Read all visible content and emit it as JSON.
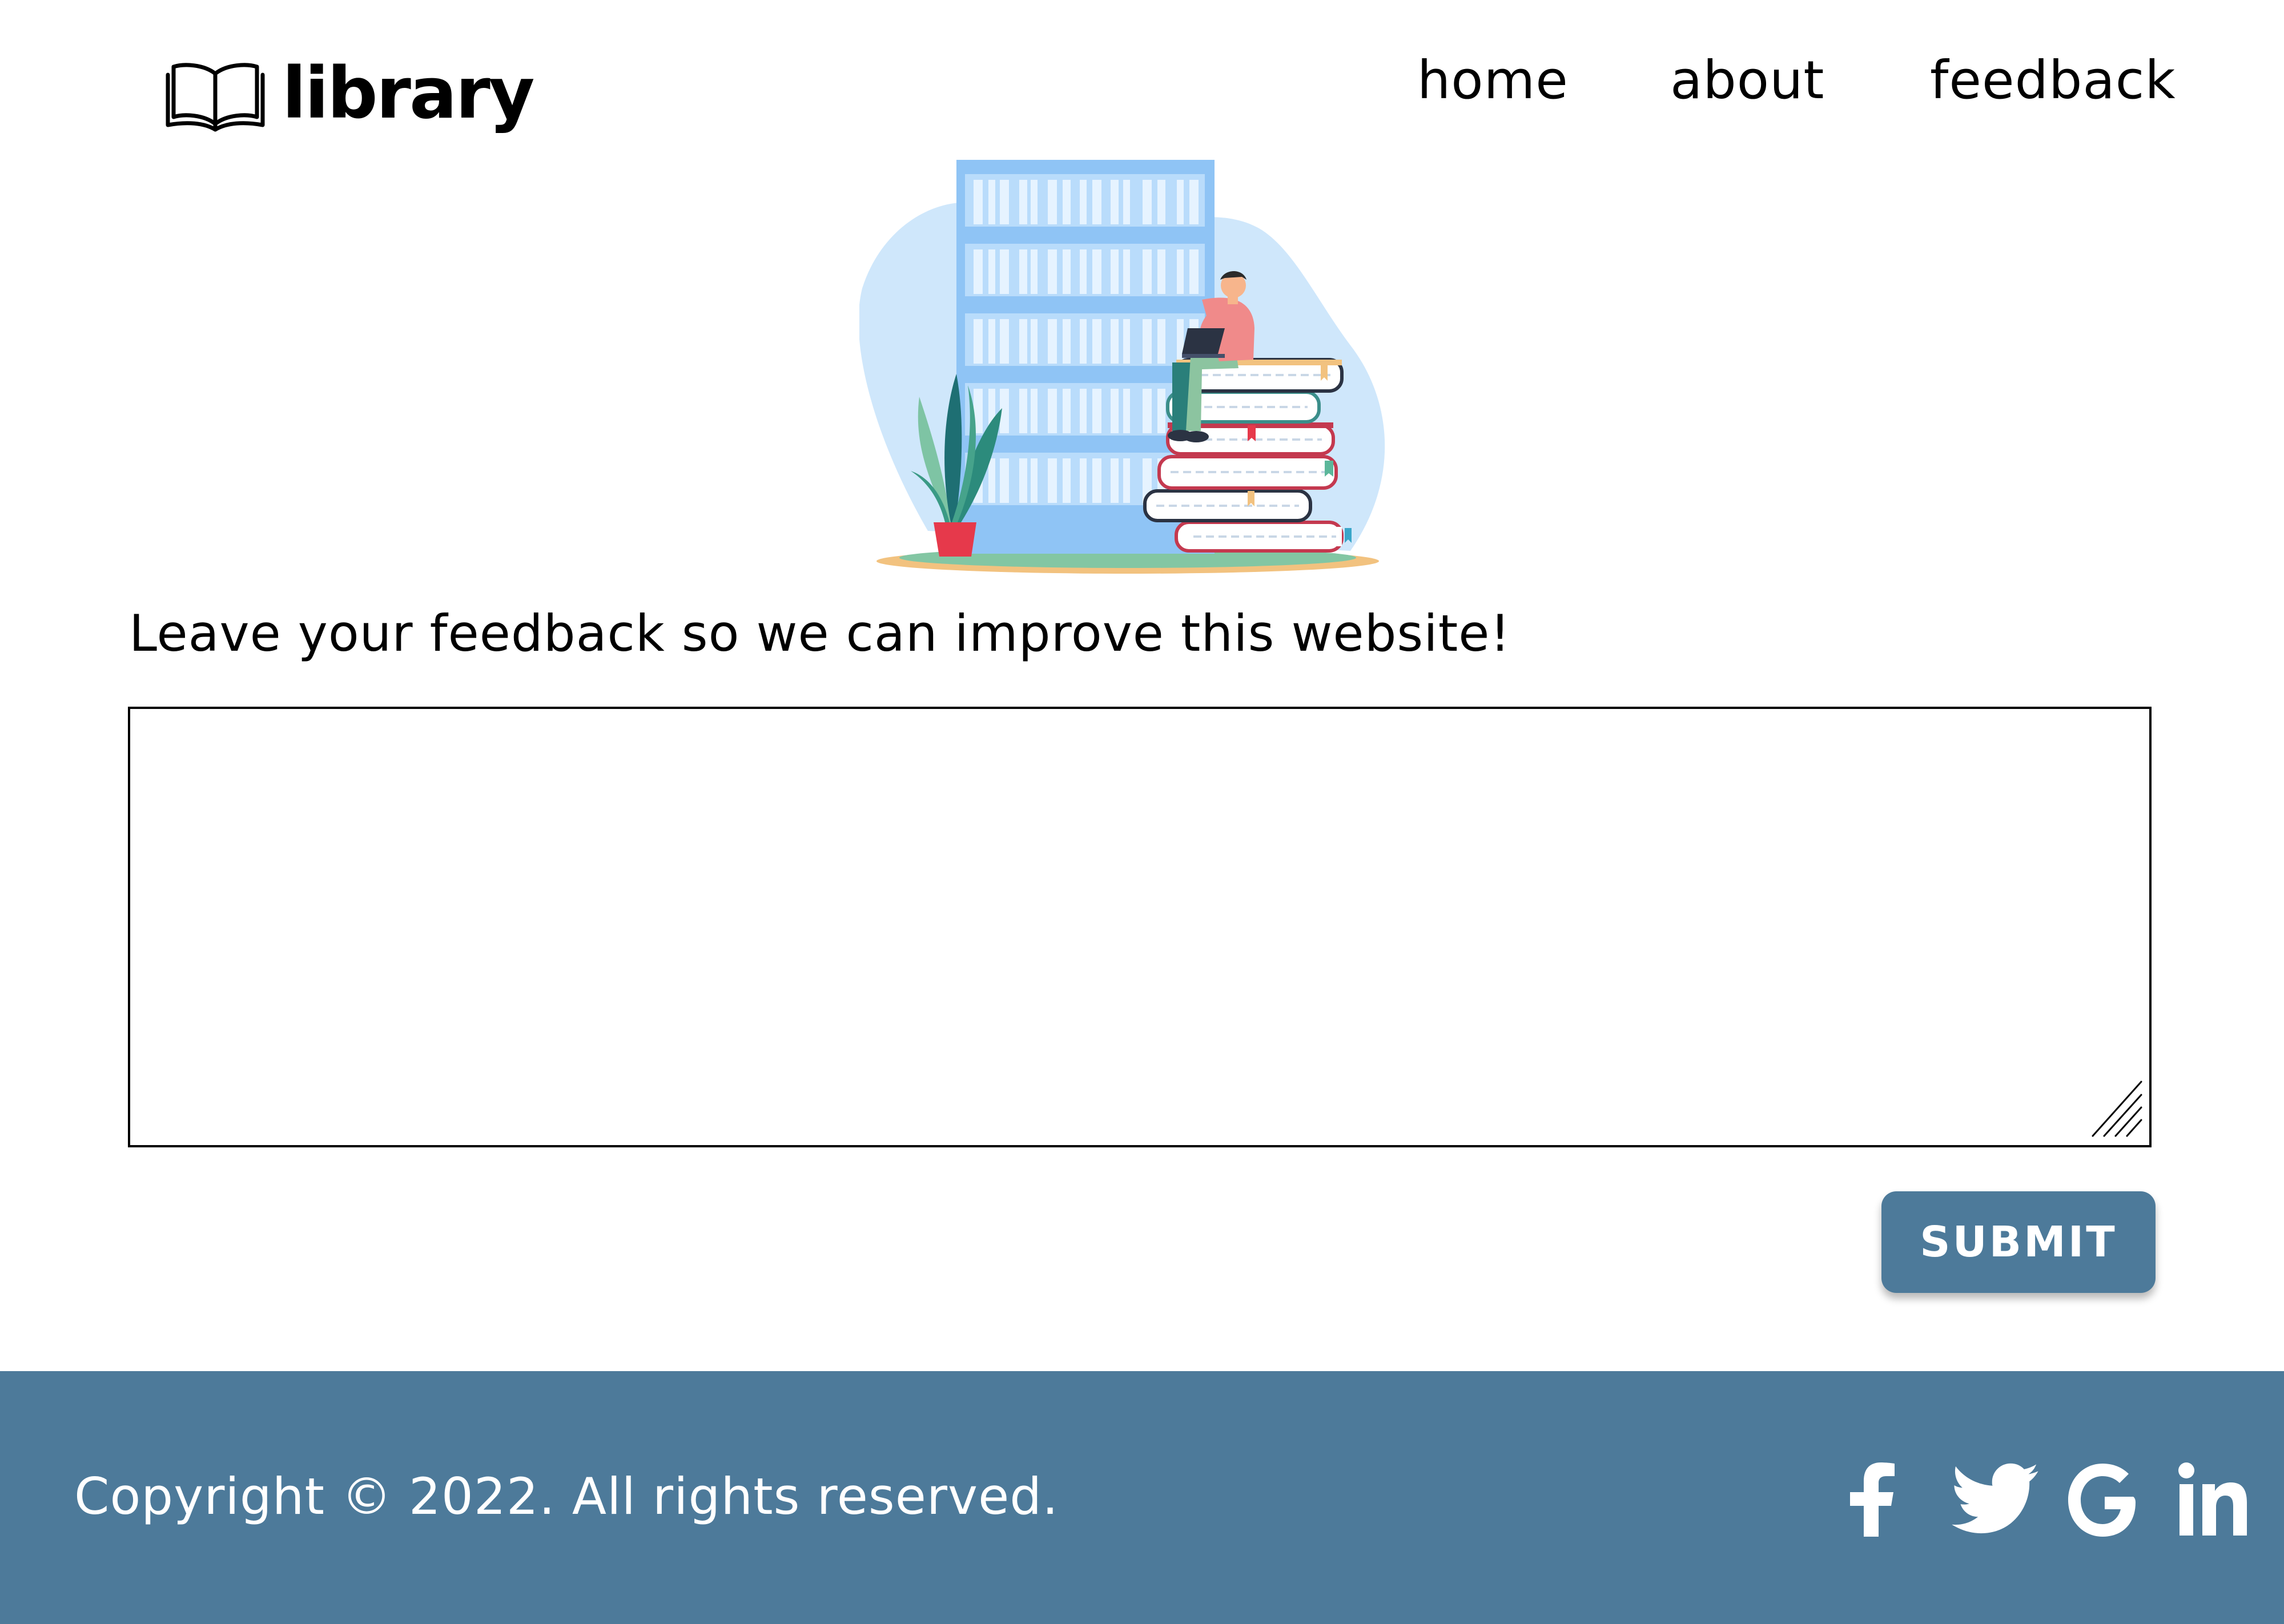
{
  "header": {
    "logo_text": "library",
    "nav": [
      {
        "label": "home"
      },
      {
        "label": "about"
      },
      {
        "label": "feedback"
      }
    ]
  },
  "main": {
    "prompt": "Leave your feedback so we can improve this website!",
    "feedback_value": "",
    "submit_label": "SUBMIT"
  },
  "footer": {
    "copyright": "Copyright © 2022. All rights reserved.",
    "social_icons": [
      "facebook-icon",
      "twitter-icon",
      "google-icon",
      "linkedin-icon"
    ]
  },
  "colors": {
    "accent": "#4d7a9a",
    "text": "#000000",
    "footer_text": "#ffffff",
    "background": "#ffffff"
  }
}
